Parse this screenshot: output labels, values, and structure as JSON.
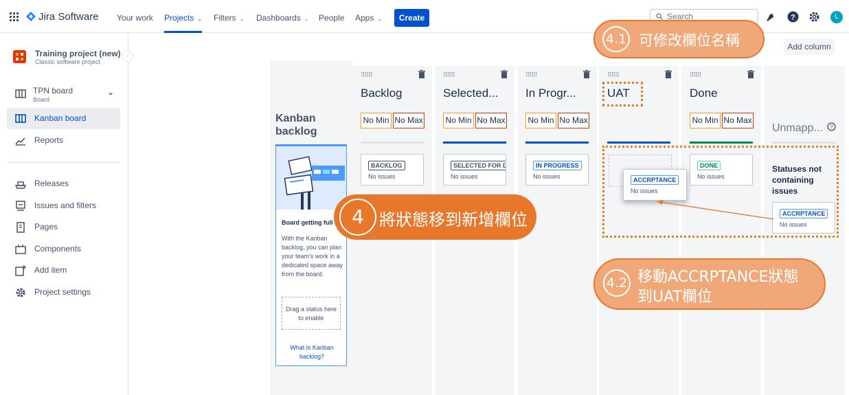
{
  "topbar": {
    "app_name": "Jira Software",
    "nav": [
      "Your work",
      "Projects",
      "Filters",
      "Dashboards",
      "People",
      "Apps"
    ],
    "create_label": "Create",
    "search_placeholder": "Search",
    "avatar_initial": "L"
  },
  "sidebar": {
    "project_name": "Training project (new)",
    "project_type": "Classic software project",
    "board_name": "TPN board",
    "board_sub": "Board",
    "items": [
      "Kanban board",
      "Reports",
      "Releases",
      "Issues and filters",
      "Pages",
      "Components",
      "Add item",
      "Project settings"
    ]
  },
  "board": {
    "add_column_label": "Add column",
    "backlog_title": "Kanban backlog",
    "backlog_panel_heading": "Board getting full",
    "backlog_panel_text": "With the Kanban backlog, you can plan your team's work in a dedicated space away from the board.",
    "drag_hint": "Drag a status here to enable",
    "what_link": "What is Kanban backlog?",
    "min_label": "No Min",
    "max_label": "No Max",
    "no_issues": "No issues",
    "columns": [
      {
        "title": "Backlog",
        "status": "BACKLOG",
        "bar_color": "#dfe1e6"
      },
      {
        "title": "Selected...",
        "status": "SELECTED FOR DE",
        "bar_color": "#0052cc"
      },
      {
        "title": "In Progr...",
        "status": "IN PROGRESS",
        "bar_color": "#0052cc"
      },
      {
        "title": "UAT",
        "status": "ACCRPTANCE",
        "bar_color": "#0052cc"
      },
      {
        "title": "Done",
        "status": "DONE",
        "bar_color": "#00875a"
      }
    ],
    "unmapped_title": "Unmapp...",
    "unmapped_heading": "Statuses not containing issues",
    "unmapped_status": "ACCRPTANCE"
  },
  "callouts": {
    "c41_num": "4.1",
    "c41_text": "可修改欄位名稱",
    "c4_num": "4",
    "c4_text": "將狀態移到新增欄位",
    "c42_num": "4.2",
    "c42_line1": "移動ACCRPTANCE狀態",
    "c42_line2": "到UAT欄位"
  },
  "colors": {
    "accent": "#0052cc",
    "callout": "#e8762b",
    "callout_light": "#f0a878",
    "lozenge_done": "#00875a"
  }
}
